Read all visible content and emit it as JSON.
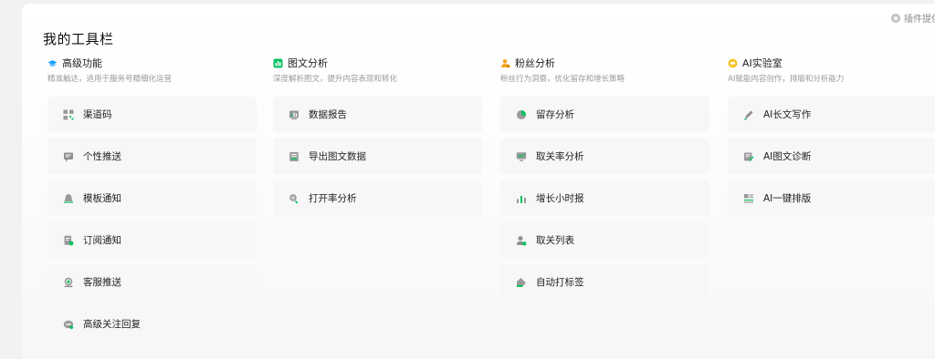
{
  "plugin_link": "插件提供",
  "page_title": "我的工具栏",
  "columns": [
    {
      "title": "高级功能",
      "desc": "精准触达，适用于服务号精细化运营",
      "header_icon": "cap-icon",
      "items": [
        {
          "label": "渠道码",
          "icon": "qrcode-icon"
        },
        {
          "label": "个性推送",
          "icon": "message-icon"
        },
        {
          "label": "模板通知",
          "icon": "bell-icon"
        },
        {
          "label": "订阅通知",
          "icon": "doc-check-icon"
        },
        {
          "label": "客服推送",
          "icon": "headset-icon"
        },
        {
          "label": "高级关注回复",
          "icon": "reply-icon"
        }
      ]
    },
    {
      "title": "图文分析",
      "desc": "深度解析图文，提升内容表现和转化",
      "header_icon": "chart-badge-icon",
      "items": [
        {
          "label": "数据报告",
          "icon": "report-icon"
        },
        {
          "label": "导出图文数据",
          "icon": "export-icon"
        },
        {
          "label": "打开率分析",
          "icon": "magnifier-icon"
        }
      ]
    },
    {
      "title": "粉丝分析",
      "desc": "粉丝行为洞察，优化留存和增长策略",
      "header_icon": "user-icon",
      "items": [
        {
          "label": "留存分析",
          "icon": "pie-icon"
        },
        {
          "label": "取关率分析",
          "icon": "monitor-icon"
        },
        {
          "label": "增长小时报",
          "icon": "bar-chart-icon"
        },
        {
          "label": "取关列表",
          "icon": "user-remove-icon"
        },
        {
          "label": "自动打标签",
          "icon": "tag-icon"
        }
      ]
    },
    {
      "title": "AI实验室",
      "desc": "AI赋能内容创作，排版和分析能力",
      "header_icon": "ai-face-icon",
      "items": [
        {
          "label": "AI长文写作",
          "icon": "pen-icon"
        },
        {
          "label": "AI图文诊断",
          "icon": "diagnose-icon"
        },
        {
          "label": "AI一键排版",
          "icon": "layout-icon"
        }
      ]
    }
  ],
  "colors": {
    "accent_green": "#07c160",
    "header_blue": "#1aa3ff",
    "header_orange": "#f5a623",
    "header_yellow": "#f7c52b"
  }
}
